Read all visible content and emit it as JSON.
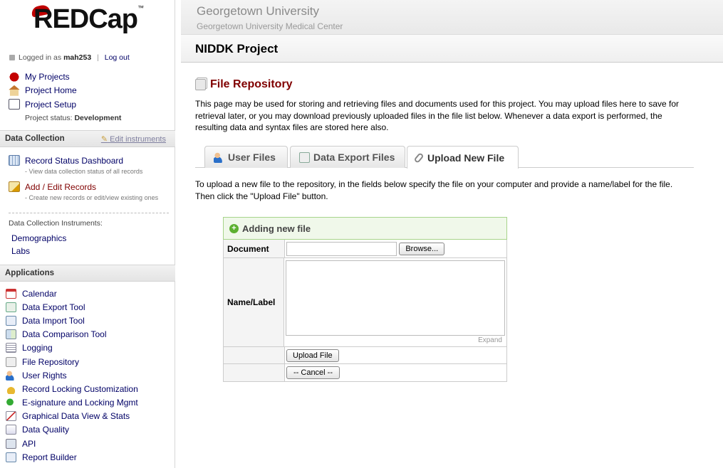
{
  "logo": {
    "text": "REDCap",
    "tm": "™"
  },
  "login": {
    "prefix": "Logged in as",
    "user": "mah253",
    "sep": "|",
    "logout": "Log out"
  },
  "nav": {
    "my_projects": "My Projects",
    "project_home": "Project Home",
    "project_setup": "Project Setup",
    "status_label": "Project status:",
    "status_value": "Development"
  },
  "data_collection": {
    "heading": "Data Collection",
    "edit_instruments": "Edit instruments",
    "dashboard": "Record Status Dashboard",
    "dashboard_sub": "- View data collection status of all records",
    "add_edit": "Add / Edit Records",
    "add_edit_sub": "- Create new records or edit/view existing ones",
    "instruments_label": "Data Collection Instruments:",
    "instruments": [
      "Demographics",
      "Labs"
    ]
  },
  "applications": {
    "heading": "Applications",
    "items": [
      "Calendar",
      "Data Export Tool",
      "Data Import Tool",
      "Data Comparison Tool",
      "Logging",
      "File Repository",
      "User Rights",
      "Record Locking Customization",
      "E-signature and Locking Mgmt",
      "Graphical Data View & Stats",
      "Data Quality",
      "API",
      "Report Builder"
    ]
  },
  "banner": {
    "institution": "Georgetown University",
    "site": "Georgetown University Medical Center"
  },
  "project": {
    "title": "NIDDK Project"
  },
  "page": {
    "title": "File Repository",
    "intro": "This page may be used for storing and retrieving files and documents used for this project. You may upload files here to save for retrieval later, or you may download previously uploaded files in the file list below. Whenever a data export is performed, the resulting data and syntax files are stored here also.",
    "tabs": [
      "User Files",
      "Data Export Files",
      "Upload New File"
    ],
    "instructions": "To upload a new file to the repository, in the fields below specify the file on your computer and provide a name/label for the file. Then click the \"Upload File\" button."
  },
  "form": {
    "heading": "Adding new file",
    "document_label": "Document",
    "browse": "Browse...",
    "name_label": "Name/Label",
    "expand": "Expand",
    "upload": "Upload File",
    "cancel": "-- Cancel --"
  }
}
